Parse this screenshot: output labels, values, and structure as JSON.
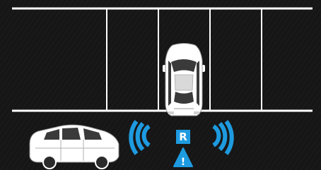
{
  "indicator": {
    "gear_label": "R",
    "warning_symbol": "!",
    "accent_color": "#1e9be0",
    "icon": "park-assist-sensor-icon"
  },
  "colors": {
    "background": "#141414",
    "lines": "#ffffff",
    "car_body": "#ffffff",
    "car_detail": "#3a3a3a"
  },
  "icons": {
    "parked_car": "car-top-view-icon",
    "passing_car": "car-side-view-icon",
    "warning": "warning-triangle-icon"
  }
}
